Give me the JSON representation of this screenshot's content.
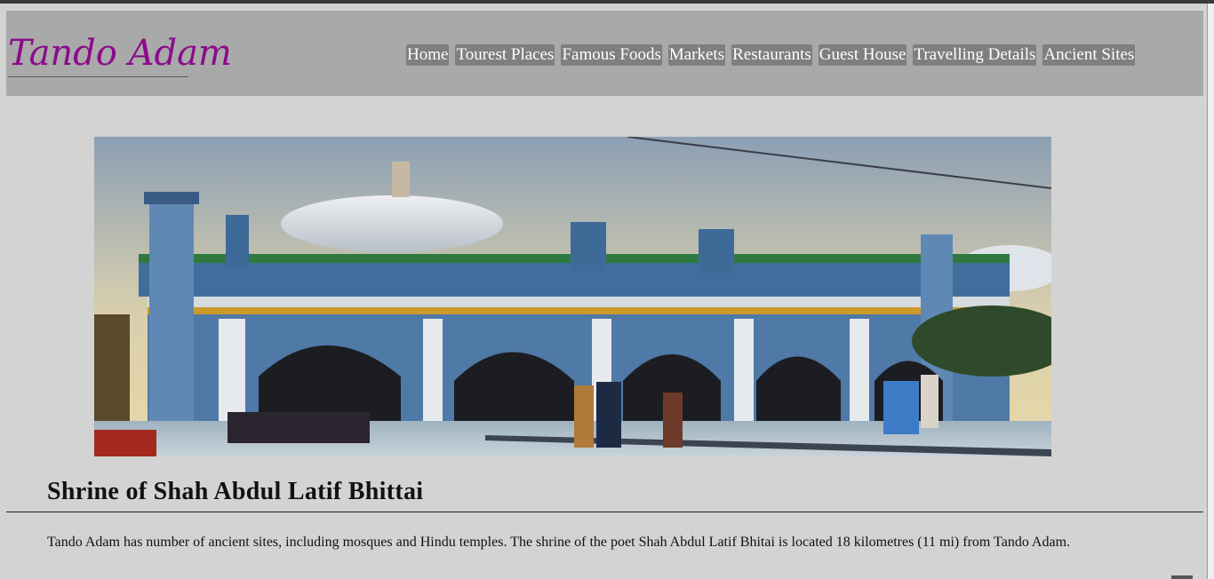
{
  "site": {
    "title": "Tando Adam"
  },
  "nav": {
    "items": [
      {
        "label": "Home"
      },
      {
        "label": "Tourest Places"
      },
      {
        "label": "Famous Foods"
      },
      {
        "label": "Markets"
      },
      {
        "label": "Restaurants"
      },
      {
        "label": "Guest House"
      },
      {
        "label": "Travelling Details"
      },
      {
        "label": "Ancient Sites"
      }
    ]
  },
  "content": {
    "heading": "Shrine of Shah Abdul Latif Bhittai",
    "paragraph": "Tando Adam has number of ancient sites, including mosques and Hindu temples. The shrine of the poet Shah Abdul Latif Bhitai is located 18 kilometres (11 mi) from Tando Adam."
  },
  "colors": {
    "page_bg": "#d3d3d3",
    "header_bg": "#a9a9a9",
    "logo": "#8b0b8b",
    "nav_bg": "#7f7f7f",
    "nav_text": "#ffffff"
  }
}
